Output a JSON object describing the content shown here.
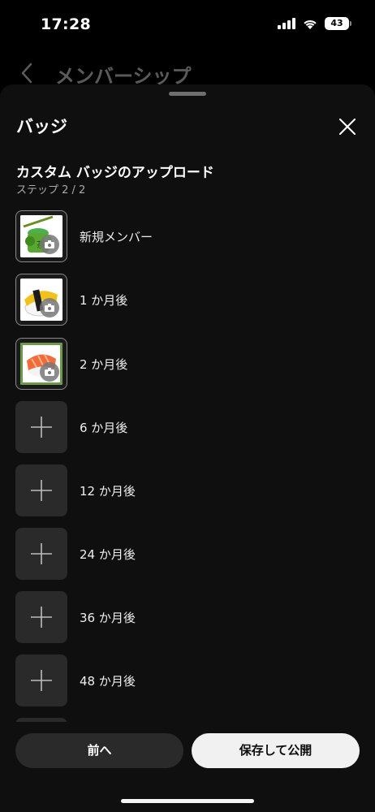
{
  "status_bar": {
    "time": "17:28",
    "battery": "43"
  },
  "background_screen": {
    "title": "メンバーシップ"
  },
  "sheet": {
    "title": "バッジ",
    "section_title": "カスタム バッジのアップロード",
    "step": "ステップ 2 / 2"
  },
  "badges": [
    {
      "label": "新規メンバー",
      "filled": true,
      "image": "green-tea"
    },
    {
      "label": "1 か月後",
      "filled": true,
      "image": "tamago-sushi"
    },
    {
      "label": "2 か月後",
      "filled": true,
      "image": "salmon-sushi"
    },
    {
      "label": "6 か月後",
      "filled": false
    },
    {
      "label": "12 か月後",
      "filled": false
    },
    {
      "label": "24 か月後",
      "filled": false
    },
    {
      "label": "36 か月後",
      "filled": false
    },
    {
      "label": "48 か月後",
      "filled": false
    }
  ],
  "buttons": {
    "prev": "前へ",
    "save": "保存して公開"
  }
}
